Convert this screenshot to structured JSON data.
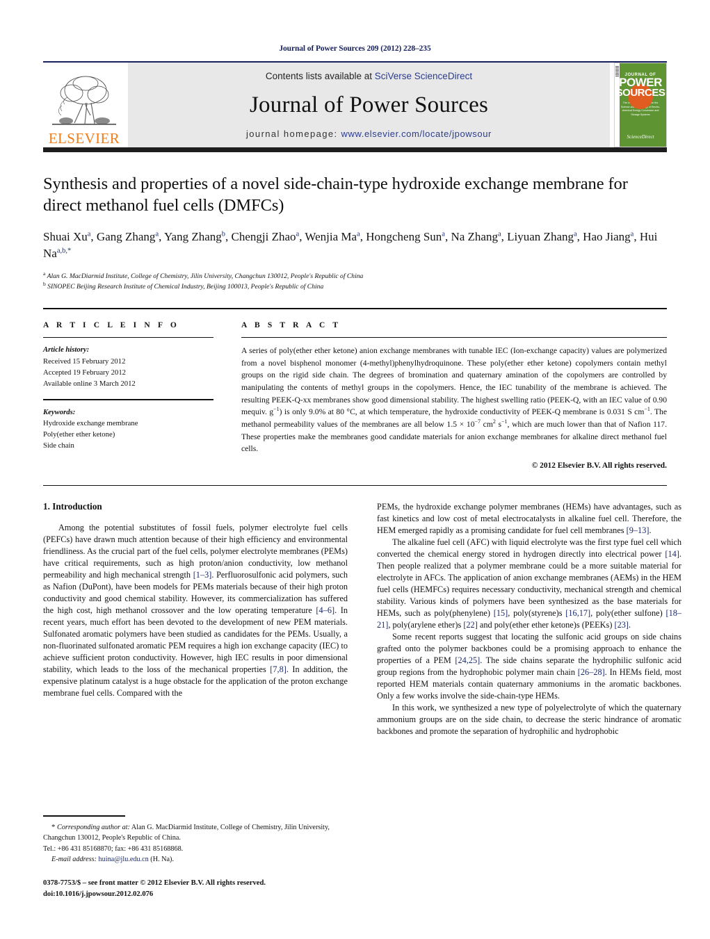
{
  "running_head": "Journal of Power Sources 209 (2012) 228–235",
  "masthead": {
    "elsevier_wordmark": "ELSEVIER",
    "contents_prefix": "Contents lists available at ",
    "contents_link": "SciVerse ScienceDirect",
    "journal_name": "Journal of Power Sources",
    "homepage_prefix": "journal homepage: ",
    "homepage_url": "www.elsevier.com/locate/jpowsour",
    "cover": {
      "line1": "JOURNAL OF",
      "line2": "POWER",
      "line3": "SOURCES",
      "subtitle": "The International Journal on the Science and Technology of Electro-chemical Energy Conversion and Storage Systems",
      "publisher_mark": "ScienceDirect"
    }
  },
  "article": {
    "title": "Synthesis and properties of a novel side-chain-type hydroxide exchange membrane for direct methanol fuel cells (DMFCs)",
    "authors_html": "Shuai Xu<sup>a</sup>, Gang Zhang<sup>a</sup>, Yang Zhang<sup>b</sup>, Chengji Zhao<sup>a</sup>, Wenjia Ma<sup>a</sup>, Hongcheng Sun<sup>a</sup>, Na Zhang<sup>a</sup>, Liyuan Zhang<sup>a</sup>, Hao Jiang<sup>a</sup>, Hui Na<sup>a,b,</sup><sup>*</sup>",
    "affiliation_a": "Alan G. MacDiarmid Institute, College of Chemistry, Jilin University, Changchun 130012, People's Republic of China",
    "affiliation_b": "SINOPEC Beijing Research Institute of Chemical Industry, Beijing 100013, People's Republic of China"
  },
  "article_info": {
    "heading": "A R T I C L E   I N F O",
    "history_label": "Article history:",
    "received": "Received 15 February 2012",
    "accepted": "Accepted 19 February 2012",
    "available": "Available online 3 March 2012",
    "keywords_label": "Keywords:",
    "keywords": [
      "Hydroxide exchange membrane",
      "Poly(ether ether ketone)",
      "Side chain"
    ]
  },
  "abstract": {
    "heading": "A B S T R A C T",
    "text_html": "A series of poly(ether ether ketone) anion exchange membranes with tunable IEC (Ion-exchange capacity) values are polymerized from a novel bisphenol monomer (4-methyl)phenylhydroquinone. These poly(ether ether ketone) copolymers contain methyl groups on the rigid side chain. The degrees of bromination and quaternary amination of the copolymers are controlled by manipulating the contents of methyl groups in the copolymers. Hence, the IEC tunability of the membrane is achieved. The resulting PEEK-Q-xx membranes show good dimensional stability. The highest swelling ratio (PEEK-Q, with an IEC value of 0.90 mequiv. g<sup>−1</sup>) is only 9.0% at 80 °C, at which temperature, the hydroxide conductivity of PEEK-Q membrane is 0.031 S cm<sup>−1</sup>. The methanol permeability values of the membranes are all below 1.5 &times; 10<sup>−7</sup> cm<sup>2</sup> s<sup>−1</sup>, which are much lower than that of Nafion 117. These properties make the membranes good candidate materials for anion exchange membranes for alkaline direct methanol fuel cells.",
    "copyright": "© 2012 Elsevier B.V. All rights reserved."
  },
  "introduction": {
    "heading": "1.  Introduction",
    "left_paragraphs_html": [
      "Among the potential substitutes of fossil fuels, polymer electrolyte fuel cells (PEFCs) have drawn much attention because of their high efficiency and environmental friendliness. As the crucial part of the fuel cells, polymer electrolyte membranes (PEMs) have critical requirements, such as high proton/anion conductivity, low methanol permeability and high mechanical strength <span class=\"ref\">[1–3]</span>. Perfluorosulfonic acid polymers, such as Nafion (DuPont), have been models for PEMs materials because of their high proton conductivity and good chemical stability. However, its commercialization has suffered the high cost, high methanol crossover and the low operating temperature <span class=\"ref\">[4–6]</span>. In recent years, much effort has been devoted to the development of new PEM materials. Sulfonated aromatic polymers have been studied as candidates for the PEMs. Usually, a non-fluorinated sulfonated aromatic PEM requires a high ion exchange capacity (IEC) to achieve sufficient proton conductivity. However, high IEC results in poor dimensional stability, which leads to the loss of the mechanical properties <span class=\"ref\">[7,8]</span>. In addition, the expensive platinum catalyst is a huge obstacle for the application of the proton exchange membrane fuel cells. Compared with the"
    ],
    "right_paragraphs_html": [
      "PEMs, the hydroxide exchange polymer membranes (HEMs) have advantages, such as fast kinetics and low cost of metal electrocatalysts in alkaline fuel cell. Therefore, the HEM emerged rapidly as a promising candidate for fuel cell membranes <span class=\"ref\">[9–13]</span>.",
      "The alkaline fuel cell (AFC) with liquid electrolyte was the first type fuel cell which converted the chemical energy stored in hydrogen directly into electrical power <span class=\"ref\">[14]</span>. Then people realized that a polymer membrane could be a more suitable material for electrolyte in AFCs. The application of anion exchange membranes (AEMs) in the HEM fuel cells (HEMFCs) requires necessary conductivity, mechanical strength and chemical stability. Various kinds of polymers have been synthesized as the base materials for HEMs, such as poly(phenylene) <span class=\"ref\">[15]</span>, poly(styrene)s <span class=\"ref\">[16,17]</span>, poly(ether sulfone) <span class=\"ref\">[18–21]</span>, poly(arylene ether)s <span class=\"ref\">[22]</span> and poly(ether ether ketone)s (PEEKs) <span class=\"ref\">[23]</span>.",
      "Some recent reports suggest that locating the sulfonic acid groups on side chains grafted onto the polymer backbones could be a promising approach to enhance the properties of a PEM <span class=\"ref\">[24,25]</span>. The side chains separate the hydrophilic sulfonic acid group regions from the hydrophobic polymer main chain <span class=\"ref\">[26–28]</span>. In HEMs field, most reported HEM materials contain quaternary ammoniums in the aromatic backbones. Only a few works involve the side-chain-type HEMs.",
      "In this work, we synthesized a new type of polyelectrolyte of which the quaternary ammonium groups are on the side chain, to decrease the steric hindrance of aromatic backbones and promote the separation of hydrophilic and hydrophobic"
    ]
  },
  "footnote": {
    "corresponding_html": "<span style=\"font-size:11px\">*</span> <i>Corresponding author at:</i> Alan G. MacDiarmid Institute, College of Chemistry, Jilin University, Changchun 130012, People's Republic of China.",
    "tel_line": "Tel.: +86 431 85168870; fax: +86 431 85168868.",
    "email_label": "E-mail address:",
    "email": "huina@jlu.edu.cn",
    "email_suffix": "(H. Na).",
    "issn_line": "0378-7753/$ – see front matter © 2012 Elsevier B.V. All rights reserved.",
    "doi_line": "doi:10.1016/j.jpowsour.2012.02.076"
  }
}
